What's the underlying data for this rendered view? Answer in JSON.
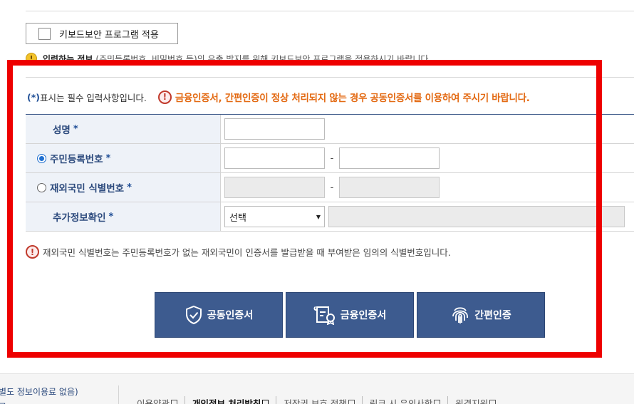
{
  "keyboard_security": {
    "label": "키보드보안 프로그램 적용"
  },
  "keyboard_notice": {
    "icon": "!",
    "bold": "입력하는 정보",
    "text": "(주민등록번호, 비밀번호 등)의 유출 방지를 위해 키보드보안 프로그램을 적용하시기 바랍니다."
  },
  "required_note": {
    "star": "(*)",
    "text": "표시는 필수 입력사항입니다."
  },
  "warning": {
    "icon": "!",
    "text": "금융인증서, 간편인증이 정상 처리되지 않는 경우 공동인증서를 이용하여 주시기 바랍니다."
  },
  "form": {
    "required_mark": "*",
    "dash": "-",
    "name_label": "성명",
    "rrn_label": "주민등록번호",
    "foreign_label": "재외국민 식별번호",
    "extra_label": "추가정보확인",
    "extra_select_value": "선택",
    "rrn_selected": true
  },
  "info_note": {
    "icon": "!",
    "text": "재외국민 식별번호는 주민등록번호가 없는 재외국민이 인증서를 발급받을 때 부여받은 임의의 식별번호입니다."
  },
  "buttons": {
    "joint": "공동인증서",
    "financial": "금융인증서",
    "simple": "간편인증"
  },
  "footer": {
    "left": "별도 정보이용료 없음)",
    "left2": "구",
    "links": [
      "이용약관",
      "개인정보 처리방침",
      "저작권 보호 정책",
      "링크 시 유의사항",
      "원격지원"
    ]
  },
  "colors": {
    "accent": "#3d5b8f",
    "warning_orange": "#e36a13",
    "frame_red": "#ee0000"
  }
}
